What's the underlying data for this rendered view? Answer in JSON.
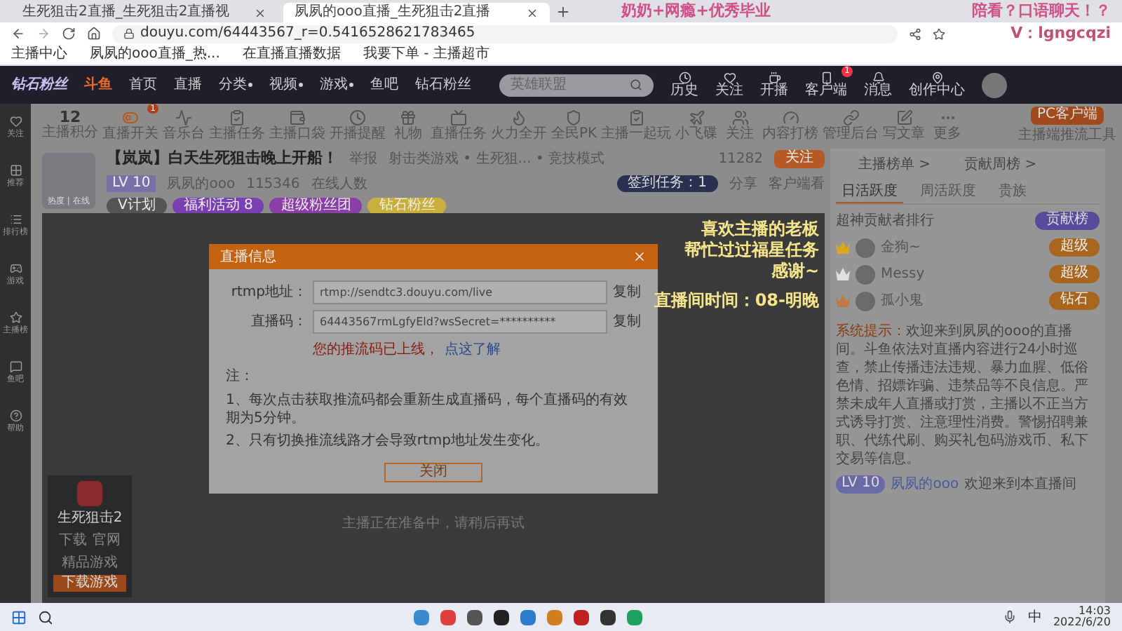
{
  "browser": {
    "tabs": [
      {
        "label": "生死狙击2直播_生死狙击2直播视",
        "selected": false
      },
      {
        "label": "夙夙的ooo直播_生死狙击2直播",
        "selected": true
      }
    ],
    "address": "douyu.com/64443567_r=0.5416528621783465",
    "bookmarks": [
      "主播中心",
      "夙夙的ooo直播_热...",
      "在直播直播数据",
      "我要下单 - 主播超市"
    ]
  },
  "header": {
    "logo": "钻石粉丝",
    "brand": "斗鱼",
    "nav": [
      {
        "label": "首页",
        "dropdown": false
      },
      {
        "label": "直播",
        "dropdown": false
      },
      {
        "label": "分类",
        "dropdown": true
      },
      {
        "label": "视频",
        "dropdown": true
      },
      {
        "label": "游戏",
        "dropdown": true
      },
      {
        "label": "鱼吧",
        "dropdown": false
      },
      {
        "label": "钻石粉丝",
        "dropdown": false
      }
    ],
    "search": {
      "placeholder": "英雄联盟"
    },
    "actions": [
      {
        "kind": "clock",
        "label": "历史"
      },
      {
        "kind": "heart",
        "label": "关注"
      },
      {
        "kind": "cup",
        "label": "开播"
      },
      {
        "kind": "phone",
        "label": "客户端",
        "badge": "1"
      },
      {
        "kind": "bell",
        "label": "消息"
      },
      {
        "kind": "pin",
        "label": "创作中心"
      }
    ]
  },
  "sidebar": [
    {
      "kind": "heart",
      "label": "关注"
    },
    {
      "kind": "grid",
      "label": "推荐"
    },
    {
      "kind": "list",
      "label": "排行榜"
    },
    {
      "kind": "game",
      "label": "游戏"
    },
    {
      "kind": "star",
      "label": "主播榜"
    },
    {
      "kind": "chat",
      "label": "鱼吧"
    },
    {
      "kind": "help",
      "label": "帮助"
    }
  ],
  "tools": [
    {
      "kind": "score",
      "label": "主播积分",
      "value": "12"
    },
    {
      "kind": "toggle",
      "label": "直播开关",
      "badge": "1"
    },
    {
      "kind": "wave",
      "label": "音乐台"
    },
    {
      "kind": "task",
      "label": "主播任务"
    },
    {
      "kind": "pocket",
      "label": "主播口袋"
    },
    {
      "kind": "clock",
      "label": "开播提醒"
    },
    {
      "kind": "gift",
      "label": "礼物"
    },
    {
      "kind": "ad",
      "label": "直播任务"
    },
    {
      "kind": "fire",
      "label": "火力全开"
    },
    {
      "kind": "shield",
      "label": "全民PK"
    },
    {
      "kind": "task",
      "label": "主播一起玩"
    },
    {
      "kind": "ufo",
      "label": "小飞碟"
    },
    {
      "kind": "people",
      "label": "关注"
    },
    {
      "kind": "gauge",
      "label": "内容打榜"
    },
    {
      "kind": "link",
      "label": "管理后台"
    },
    {
      "kind": "pen",
      "label": "写文章"
    },
    {
      "kind": "more",
      "label": "更多"
    }
  ],
  "pc_button": "PC客户端",
  "pc_note": "主播端推流工具",
  "streamer": {
    "title": "【岚岚】白天生死狙击晚上开船！",
    "report": "举报",
    "category": "射击类游戏 • 生死狙... • 竞技模式",
    "level": "LV 10",
    "name": "夙夙的ooo",
    "heat": "115346",
    "rank": "在线人数",
    "avatar_tag": "热度 | 在线",
    "tags": [
      {
        "label": "V计划",
        "color": "#555555"
      },
      {
        "label": "福利活动 8",
        "color": "#7a3fb0"
      },
      {
        "label": "超级粉丝团",
        "color": "#8a3fa8"
      },
      {
        "label": "钻石粉丝",
        "color": "#c9b03c"
      }
    ],
    "followers": "11282",
    "follow": "关注",
    "task": "签到任务：1",
    "share": "分享",
    "client": "客户端看"
  },
  "dialog": {
    "title": "直播信息",
    "rows": [
      {
        "label": "rtmp地址：",
        "value": "rtmp://sendtc3.douyu.com/live",
        "action": "复制"
      },
      {
        "label": "直播码：",
        "value": "64443567rmLgfyEld?wsSecret=**********",
        "action": "复制"
      }
    ],
    "warning": "您的推流码已上线，",
    "link": "点这了解",
    "note_title": "注：",
    "notes": [
      "1、每次点击获取推流码都会重新生成直播码，每个直播码的有效期为5分钟。",
      "2、只有切换推流线路才会导致rtmp地址发生变化。"
    ],
    "close": "关闭"
  },
  "video_message": "主播正在准备中，请稍后再试",
  "game_card": {
    "title": "生死狙击2",
    "stats": [
      "下载",
      "官网"
    ],
    "tag": "精品游戏",
    "button": "下载游戏"
  },
  "right": {
    "links": [
      "主播榜单 >",
      "贡献周榜 >"
    ],
    "tabs": [
      {
        "label": "日活跃度",
        "selected": true
      },
      {
        "label": "周活跃度",
        "selected": false
      },
      {
        "label": "贵族",
        "selected": false
      }
    ],
    "rank_title": "超神贡献者排行",
    "rank_button": "贡献榜",
    "ranks": [
      {
        "name": "金狗~",
        "badge": "超级",
        "color": "#d9a81e"
      },
      {
        "name": "Messy",
        "badge": "超级",
        "color": "#e0e0e0"
      },
      {
        "name": "孤小鬼",
        "badge": "钻石",
        "color": "#c07a4a"
      }
    ],
    "system_label": "系统提示：",
    "system_text": "欢迎来到夙夙的ooo的直播间。斗鱼依法对直播内容进行24小时巡查，禁止传播违法违规、暴力血腥、低俗色情、招嫖诈骗、违禁品等不良信息。严禁未成年人直播或打赏，主播以不正当方式诱导打赏、注意理性消费。警惕招聘兼职、代练代刷、购买礼包码游戏币、私下交易等信息。",
    "welcome_level": "LV 10",
    "welcome_name": "夙夙的ooo",
    "welcome_text": "欢迎来到本直播间"
  },
  "overlays": {
    "top": "奶奶+网瘾+优秀毕业",
    "top_right": "陪看？口语聊天！？",
    "wechat": "V：lgngcqzi",
    "thanks": [
      "喜欢主播的老板",
      "帮忙过过福星任务",
      "感谢~"
    ],
    "schedule": "直播间时间：08-明晚"
  },
  "taskbar": {
    "ime": "中",
    "time": "14:03",
    "date": "2022/6/20"
  }
}
